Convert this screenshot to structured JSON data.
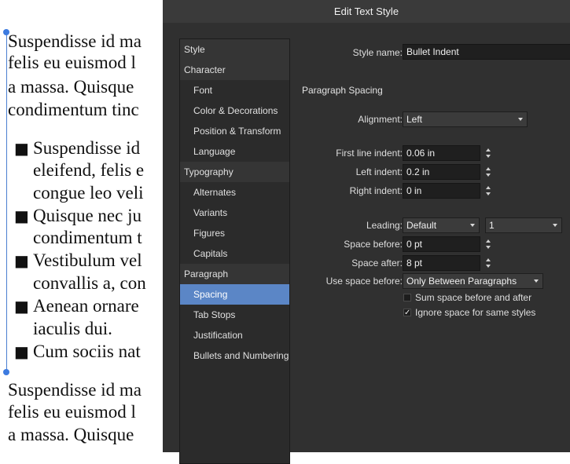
{
  "document": {
    "para1": [
      "Suspendisse id ma",
      "felis eu euismod l",
      "a massa. Quisque",
      "condimentum tinc"
    ],
    "bullets": [
      {
        "lines": [
          "Suspendisse id",
          "eleifend, felis e",
          "congue leo veli"
        ]
      },
      {
        "lines": [
          "Quisque nec ju",
          "condimentum t"
        ]
      },
      {
        "lines": [
          "Vestibulum vel",
          "convallis a, con"
        ]
      },
      {
        "lines": [
          "Aenean ornare",
          "iaculis dui."
        ]
      },
      {
        "lines": [
          "Cum sociis nat"
        ]
      }
    ],
    "bullet_glyph": "■",
    "para2": [
      "Suspendisse id ma",
      "felis eu euismod l",
      "a massa. Quisque"
    ]
  },
  "dialog": {
    "title": "Edit Text Style",
    "sidebar": [
      {
        "label": "Style",
        "kind": "cat"
      },
      {
        "label": "Character",
        "kind": "cat"
      },
      {
        "label": "Font",
        "kind": "sub"
      },
      {
        "label": "Color & Decorations",
        "kind": "sub"
      },
      {
        "label": "Position & Transform",
        "kind": "sub"
      },
      {
        "label": "Language",
        "kind": "sub"
      },
      {
        "label": "Typography",
        "kind": "cat"
      },
      {
        "label": "Alternates",
        "kind": "sub"
      },
      {
        "label": "Variants",
        "kind": "sub"
      },
      {
        "label": "Figures",
        "kind": "sub"
      },
      {
        "label": "Capitals",
        "kind": "sub"
      },
      {
        "label": "Paragraph",
        "kind": "cat"
      },
      {
        "label": "Spacing",
        "kind": "sub",
        "selected": true
      },
      {
        "label": "Tab Stops",
        "kind": "sub"
      },
      {
        "label": "Justification",
        "kind": "sub"
      },
      {
        "label": "Bullets and Numbering",
        "kind": "sub"
      }
    ],
    "style_name": {
      "label": "Style name:",
      "value": "Bullet Indent"
    },
    "section_title": "Paragraph Spacing",
    "alignment": {
      "label": "Alignment:",
      "value": "Left"
    },
    "first_line_indent": {
      "label": "First line indent:",
      "value": "0.06 in"
    },
    "left_indent": {
      "label": "Left indent:",
      "value": "0.2 in"
    },
    "right_indent": {
      "label": "Right indent:",
      "value": "0 in"
    },
    "leading": {
      "label": "Leading:",
      "value": "Default",
      "multiplier": "1"
    },
    "space_before": {
      "label": "Space before:",
      "value": "0 pt"
    },
    "space_after": {
      "label": "Space after:",
      "value": "8 pt"
    },
    "use_space_before": {
      "label": "Use space before:",
      "value": "Only Between Paragraphs"
    },
    "sum_space": {
      "label": "Sum space before and after",
      "checked": false
    },
    "ignore_space": {
      "label": "Ignore space for same styles",
      "checked": true
    },
    "check_glyph": "✓",
    "accent_color": "#5b86c6"
  }
}
